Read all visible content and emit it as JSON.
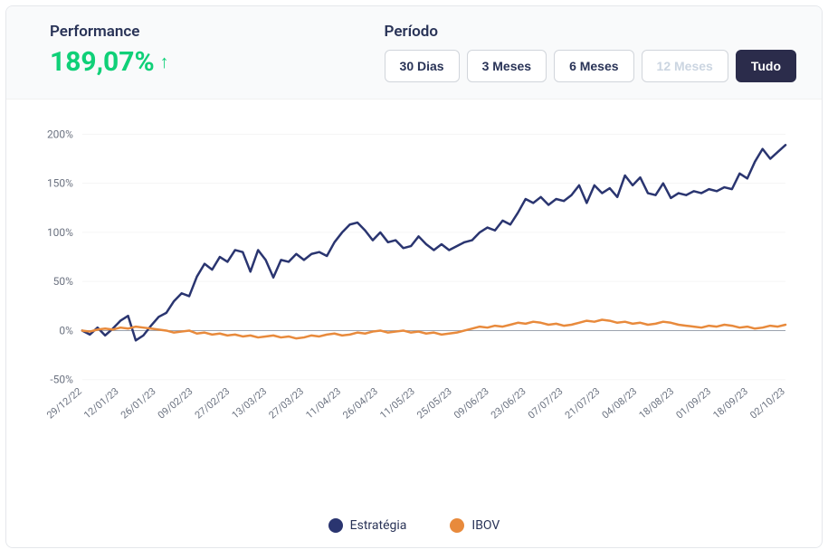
{
  "header": {
    "performance_label": "Performance",
    "performance_value": "189,07%",
    "trend": "up",
    "period_label": "Período",
    "buttons": {
      "d30": "30 Dias",
      "m3": "3 Meses",
      "m6": "6 Meses",
      "m12": "12 Meses",
      "all": "Tudo"
    }
  },
  "chart_data": {
    "type": "line",
    "title": "",
    "xlabel": "",
    "ylabel": "",
    "ylim": [
      -50,
      200
    ],
    "y_ticks": [
      -50,
      0,
      50,
      100,
      150,
      200
    ],
    "y_tick_labels": [
      "-50%",
      "0%",
      "50%",
      "100%",
      "150%",
      "200%"
    ],
    "categories": [
      "29/12/22",
      "12/01/23",
      "26/01/23",
      "09/02/23",
      "27/02/23",
      "13/03/23",
      "27/03/23",
      "11/04/23",
      "26/04/23",
      "11/05/23",
      "25/05/23",
      "09/06/23",
      "23/06/23",
      "07/07/23",
      "21/07/23",
      "04/08/23",
      "18/08/23",
      "01/09/23",
      "18/09/23",
      "02/10/23"
    ],
    "series": [
      {
        "name": "Estratégia",
        "color": "#2a3570",
        "values": [
          0,
          -4,
          3,
          -5,
          2,
          10,
          15,
          -10,
          -5,
          5,
          14,
          18,
          30,
          38,
          35,
          55,
          68,
          62,
          75,
          70,
          82,
          80,
          60,
          82,
          72,
          54,
          72,
          70,
          78,
          72,
          78,
          80,
          76,
          90,
          100,
          108,
          110,
          102,
          92,
          100,
          90,
          92,
          84,
          86,
          96,
          88,
          82,
          88,
          82,
          86,
          90,
          92,
          100,
          105,
          102,
          112,
          108,
          120,
          134,
          130,
          136,
          128,
          134,
          132,
          138,
          148,
          130,
          148,
          140,
          145,
          136,
          158,
          148,
          156,
          140,
          138,
          150,
          135,
          140,
          138,
          142,
          140,
          144,
          142,
          146,
          144,
          160,
          155,
          172,
          185,
          175,
          182,
          189
        ]
      },
      {
        "name": "IBOV",
        "color": "#e88a3c",
        "values": [
          0,
          -1,
          1,
          2,
          1,
          3,
          2,
          4,
          3,
          2,
          1,
          0,
          -2,
          -1,
          0,
          -3,
          -2,
          -4,
          -3,
          -5,
          -4,
          -6,
          -5,
          -7,
          -6,
          -5,
          -7,
          -6,
          -8,
          -7,
          -5,
          -6,
          -4,
          -3,
          -5,
          -4,
          -2,
          -3,
          -1,
          0,
          -2,
          -1,
          0,
          -2,
          -1,
          -3,
          -2,
          -4,
          -3,
          -2,
          0,
          2,
          4,
          3,
          5,
          4,
          6,
          8,
          7,
          9,
          8,
          6,
          7,
          5,
          6,
          8,
          10,
          9,
          11,
          10,
          8,
          9,
          7,
          8,
          6,
          7,
          9,
          8,
          6,
          5,
          4,
          3,
          5,
          4,
          6,
          5,
          3,
          4,
          2,
          3,
          5,
          4,
          6
        ]
      }
    ],
    "legend_position": "bottom"
  }
}
